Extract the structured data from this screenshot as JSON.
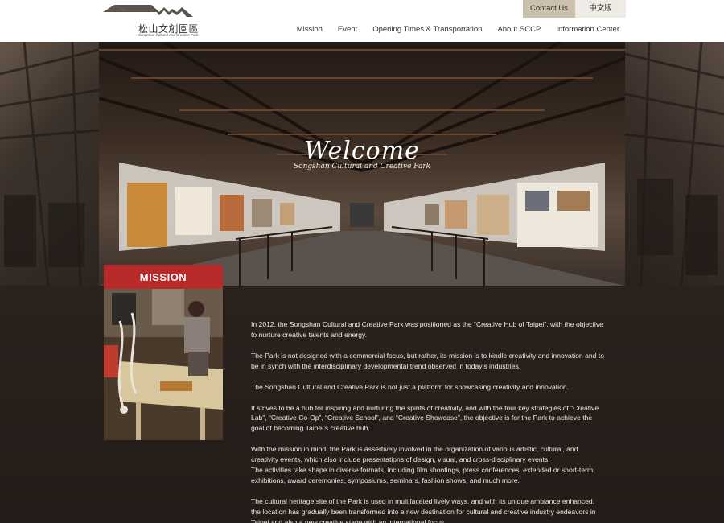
{
  "header": {
    "logo_text_cn": "松山文創園區",
    "logo_text_en": "Songshan Cultural and Creative Park",
    "contact_label": "Contact Us",
    "lang_label": "中文版",
    "nav": [
      {
        "label": "Mission"
      },
      {
        "label": "Event"
      },
      {
        "label": "Opening Times & Transportation"
      },
      {
        "label": "About SCCP"
      },
      {
        "label": "Information Center"
      }
    ]
  },
  "hero": {
    "welcome": "Welcome",
    "subtitle": "Songshan Cultural and Creative Park"
  },
  "mission": {
    "label": "MISSION",
    "paragraphs": [
      "In 2012, the Songshan Cultural and Creative Park was positioned as the “Creative Hub of Taipei”, with the objective to nurture creative talents and energy.",
      "The Park is not designed with a commercial focus, but rather, its mission is to kindle creativity and innovation and to be in synch with the interdisciplinary developmental trend observed in today’s industries.",
      "The Songshan Cultural and Creative Park is not just a platform for showcasing creativity and innovation.",
      "It strives to be a hub for inspiring and nurturing the spirits of creativity, and with the four key strategies of “Creative Lab”, “Creative Co-Op”, “Creative School”, and “Creative Showcase”, the objective is for the Park to achieve the goal of becoming Taipei’s creative hub.",
      "With the mission in mind, the Park is assertively involved in the organization of various artistic, cultural, and creativity events, which also include presentations of design, visual, and cross-disciplinary events.\n The activities take shape in diverse formats, including film shootings, press conferences, extended or short-term exhibitions, award ceremonies, symposiums, seminars, fashion shows, and much more.",
      " The cultural heritage site of the Park is used in multifaceted lively ways, and with its unique ambiance enhanced, the location has gradually been transformed into a new destination for cultural and creative industry endeavors in Taipei and also a new creative stage with an international focus."
    ]
  },
  "colors": {
    "accent_red": "#b92b2b",
    "contact_bg": "#cbbfae",
    "content_bg": "#2a221d"
  }
}
